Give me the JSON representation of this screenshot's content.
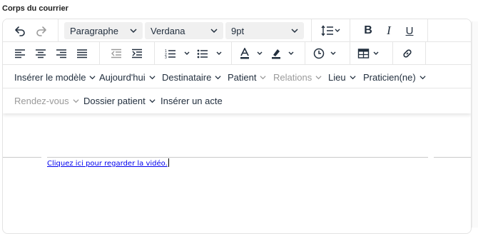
{
  "field_label": "Corps du courrier",
  "toolbar": {
    "undo_icon": "undo-icon",
    "redo_icon": "redo-icon",
    "block_format": "Paragraphe",
    "font_family": "Verdana",
    "font_size": "9pt",
    "line_height_icon": "line-height-icon",
    "bold_icon": "bold-icon",
    "italic_icon": "italic-icon",
    "underline_icon": "underline-icon",
    "row2_icons": [
      "align-left-icon",
      "align-center-icon",
      "align-right-icon",
      "align-justify-icon",
      "outdent-icon",
      "indent-icon",
      "numbered-list-icon",
      "bullet-list-icon",
      "text-color-icon",
      "highlight-color-icon",
      "insert-time-icon",
      "table-icon",
      "link-icon"
    ]
  },
  "menus": [
    {
      "label": "Insérer le modèle",
      "disabled": false
    },
    {
      "label": "Aujourd'hui",
      "disabled": false
    },
    {
      "label": "Destinataire",
      "disabled": false
    },
    {
      "label": "Patient",
      "disabled": false
    },
    {
      "label": "Relations",
      "disabled": true
    },
    {
      "label": "Lieu",
      "disabled": false
    },
    {
      "label": "Praticien(ne)",
      "disabled": false
    },
    {
      "label": "Rendez-vous",
      "disabled": true
    },
    {
      "label": "Dossier patient",
      "disabled": false
    },
    {
      "label": "Insérer un acte",
      "disabled": false
    }
  ],
  "content": {
    "link_text": "Cliquez ici pour regarder la vidéo."
  },
  "colors": {
    "text": "#222f3e",
    "disabled": "#9a9a9a",
    "link": "#0000ee",
    "select_bg": "#f0f0f0"
  }
}
